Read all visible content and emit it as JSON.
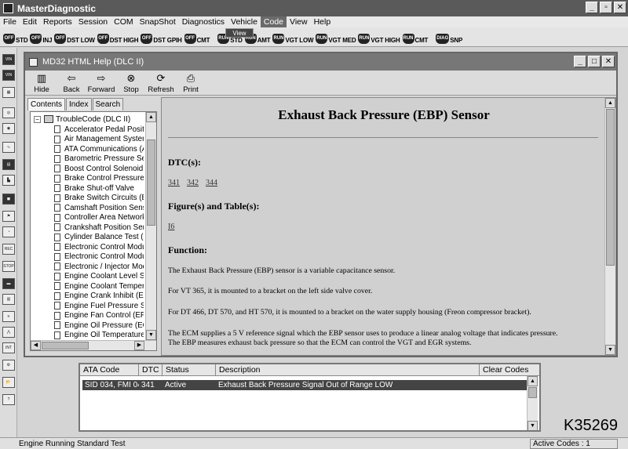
{
  "app": {
    "title": "MasterDiagnostic"
  },
  "menu": [
    "File",
    "Edit",
    "Reports",
    "Session",
    "COM",
    "SnapShot",
    "Diagnostics",
    "Vehicle",
    "Code",
    "View",
    "Help"
  ],
  "menu_active": "Code",
  "tooltip": "View",
  "toolbar": [
    {
      "badge": "OFF",
      "label": "STD"
    },
    {
      "badge": "OFF",
      "label": "INJ"
    },
    {
      "badge": "OFF",
      "label": "DST LOW"
    },
    {
      "badge": "OFF",
      "label": "DST HIGH"
    },
    {
      "badge": "OFF",
      "label": "DST GPIH"
    },
    {
      "badge": "OFF",
      "label": "CMT"
    },
    {
      "badge": "RUN",
      "label": "STD"
    },
    {
      "badge": "RUN",
      "label": "AMT"
    },
    {
      "badge": "RUN",
      "label": "VGT LOW"
    },
    {
      "badge": "RUN",
      "label": "VGT MED"
    },
    {
      "badge": "RUN",
      "label": "VGT HIGH"
    },
    {
      "badge": "RUN",
      "label": "CMT"
    },
    {
      "badge": "DIAG",
      "label": "SNP"
    }
  ],
  "help": {
    "title": "MD32 HTML Help (DLC II)",
    "buttons": [
      "Hide",
      "Back",
      "Forward",
      "Stop",
      "Refresh",
      "Print"
    ],
    "tabs": [
      "Contents",
      "Index",
      "Search"
    ],
    "tree_root": "TroubleCode (DLC II)",
    "tree_items": [
      "Accelerator Pedal Positi",
      "Air Management System",
      "ATA Communications (A",
      "Barometric Pressure Ser",
      "Boost Control Solenoid (",
      "Brake Control Pressure S",
      "Brake Shut-off Valve",
      "Brake Switch Circuits (B",
      "Camshaft Position Sens",
      "Controller Area Network",
      "Crankshaft Position Sen",
      "Cylinder Balance Test (C",
      "Electronic Control Modu",
      "Electronic Control Modu",
      "Electronic / Injector Mod",
      "Engine Coolant Level Sy",
      "Engine Coolant Tempera",
      "Engine Crank Inhibit (EC",
      "Engine Fuel Pressure Se",
      "Engine Fan Control (EFA",
      "Engine Oil Pressure (EO",
      "Engine Oil Temperature"
    ],
    "content": {
      "heading": "Exhaust Back Pressure (EBP) Sensor",
      "dtc_label": "DTC(s):",
      "dtc_links": [
        "341",
        "342",
        "344"
      ],
      "figures_label": "Figure(s) and Table(s):",
      "figure_link": "I6",
      "function_label": "Function:",
      "p1": "The Exhaust Back Pressure (EBP) sensor is a variable capacitance sensor.",
      "p2": "For VT 365, it is mounted to a bracket on the left side valve cover.",
      "p3": "For DT 466, DT 570, and HT 570, it is mounted to a bracket on the water supply housing (Freon compressor bracket).",
      "p4a": "The ECM supplies a 5 V reference signal which the EBP sensor uses to produce a linear analog voltage that indicates pressure.",
      "p4b": "The EBP measures exhaust back pressure so that the ECM can control the VGT and EGR systems."
    }
  },
  "codes": {
    "headers": [
      "ATA Code",
      "DTC",
      "Status",
      "Description",
      "Clear Codes"
    ],
    "row": {
      "ata": "SID 034, FMI 04",
      "dtc": "341",
      "status": "Active",
      "description": "Exhaust Back Pressure Signal Out of Range LOW"
    }
  },
  "figure_id": "K35269",
  "status": {
    "left": "Engine Running Standard Test",
    "right": "Active Codes : 1"
  }
}
